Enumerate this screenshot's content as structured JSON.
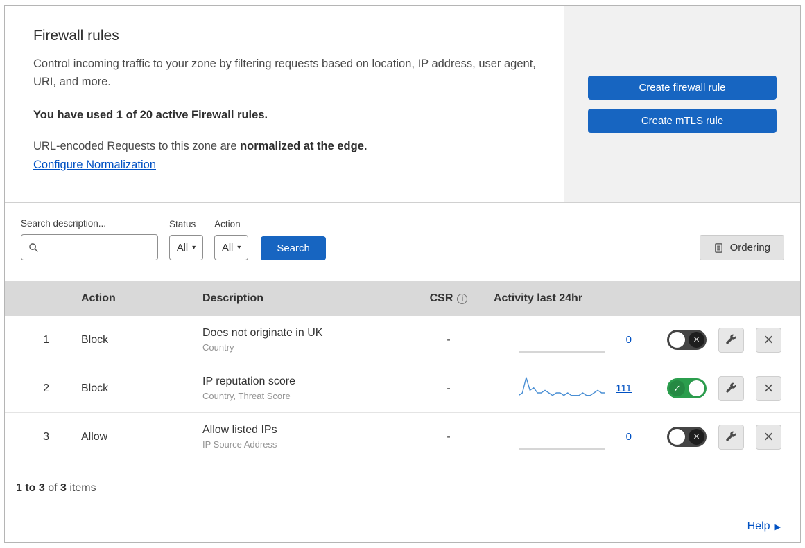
{
  "header": {
    "title": "Firewall rules",
    "description": "Control incoming traffic to your zone by filtering requests based on location, IP address, user agent, URI, and more.",
    "usage": "You have used 1 of 20 active Firewall rules.",
    "normalization": {
      "prefix": "URL-encoded Requests to this zone are ",
      "bold": "normalized at the edge.",
      "link": "Configure Normalization"
    },
    "actions": {
      "create_firewall_rule": "Create firewall rule",
      "create_mtls_rule": "Create mTLS rule"
    }
  },
  "filters": {
    "search_label": "Search description...",
    "status": {
      "label": "Status",
      "value": "All"
    },
    "action": {
      "label": "Action",
      "value": "All"
    },
    "search_button": "Search",
    "ordering_button": "Ordering"
  },
  "table": {
    "headers": {
      "action": "Action",
      "description": "Description",
      "csr": "CSR",
      "activity": "Activity last 24hr"
    },
    "rows": [
      {
        "priority": "1",
        "action": "Block",
        "description": "Does not originate in UK",
        "criteria": "Country",
        "csr": "-",
        "activity_count": "0",
        "enabled": false,
        "sparkline": [
          0,
          0,
          0,
          0,
          0,
          0,
          0,
          0,
          0,
          0,
          0,
          0,
          0,
          0,
          0,
          0,
          0,
          0,
          0,
          0,
          0,
          0,
          0,
          0
        ]
      },
      {
        "priority": "2",
        "action": "Block",
        "description": "IP reputation score",
        "criteria": "Country, Threat Score",
        "csr": "-",
        "activity_count": "111",
        "enabled": true,
        "sparkline": [
          2,
          3,
          9,
          4,
          5,
          3,
          3,
          4,
          3,
          2,
          3,
          3,
          2,
          3,
          2,
          2,
          2,
          3,
          2,
          2,
          3,
          4,
          3,
          3
        ]
      },
      {
        "priority": "3",
        "action": "Allow",
        "description": "Allow listed IPs",
        "criteria": "IP Source Address",
        "csr": "-",
        "activity_count": "0",
        "enabled": false,
        "sparkline": [
          0,
          0,
          0,
          0,
          0,
          0,
          0,
          0,
          0,
          0,
          0,
          0,
          0,
          0,
          0,
          0,
          0,
          0,
          0,
          0,
          0,
          0,
          0,
          0
        ]
      }
    ]
  },
  "footer": {
    "range": "1 to 3",
    "of": "of",
    "total": "3",
    "items": "items"
  },
  "help": "Help",
  "icons": {
    "toggle_on": "✓",
    "toggle_off": "×",
    "dropdown_caret": "▾",
    "info": "i",
    "close": "×",
    "help_arrow": "▶"
  },
  "colors": {
    "primary_button": "#1765c1",
    "link": "#0051c3",
    "toggle_on": "#2b9e4d",
    "sparkline": "#4a8fd4"
  }
}
